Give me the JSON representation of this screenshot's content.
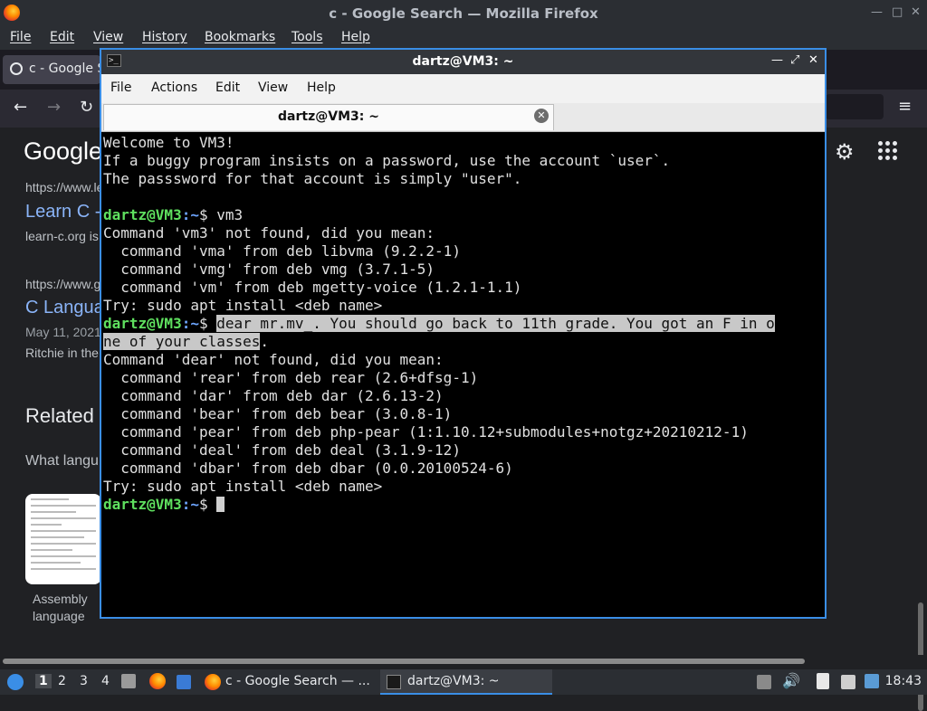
{
  "firefox": {
    "window_title": "c - Google Search — Mozilla Firefox",
    "menu": [
      "File",
      "Edit",
      "View",
      "History",
      "Bookmarks",
      "Tools",
      "Help"
    ],
    "tab_title": "c - Google S",
    "nav": {
      "back": "←",
      "forward": "→",
      "reload": "↻",
      "menu": "≡"
    }
  },
  "google": {
    "logo": "Google",
    "results": [
      {
        "url": "https://www.le",
        "title": "Learn C -",
        "snippet": "learn-c.org is"
      },
      {
        "url": "https://www.g",
        "title": "C Langua",
        "date": "May 11, 2021",
        "snippet": "Ritchie in the"
      }
    ],
    "related_heading": "Related",
    "related_question": "What langu",
    "thumb_caption_1": "Assembly",
    "thumb_caption_2": "language"
  },
  "terminal": {
    "window_title": "dartz@VM3: ~",
    "menu": [
      "File",
      "Actions",
      "Edit",
      "View",
      "Help"
    ],
    "tab_title": "dartz@VM3: ~",
    "prompt_user": "dartz@VM3",
    "prompt_path": ":~",
    "prompt_sign": "$ ",
    "lines": {
      "l1": "Welcome to VM3!",
      "l2": "If a buggy program insists on a password, use the account `user`.",
      "l3": "The passsword for that account is simply \"user\".",
      "cmd1": "vm3",
      "l5": "Command 'vm3' not found, did you mean:",
      "l6": "  command 'vma' from deb libvma (9.2.2-1)",
      "l7": "  command 'vmg' from deb vmg (3.7.1-5)",
      "l8": "  command 'vm' from deb mgetty-voice (1.2.1-1.1)",
      "l9": "Try: sudo apt install <deb name>",
      "cmd2_hl_a": "dear mr.mv_. You should go back to 11th grade. You got an F in o",
      "cmd2_hl_b": "ne of your classes",
      "cmd2_tail": ".",
      "l12": "Command 'dear' not found, did you mean:",
      "l13": "  command 'rear' from deb rear (2.6+dfsg-1)",
      "l14": "  command 'dar' from deb dar (2.6.13-2)",
      "l15": "  command 'bear' from deb bear (3.0.8-1)",
      "l16": "  command 'pear' from deb php-pear (1:1.10.12+submodules+notgz+20210212-1)",
      "l17": "  command 'deal' from deb deal (3.1.9-12)",
      "l18": "  command 'dbar' from deb dbar (0.0.20100524-6)",
      "l19": "Try: sudo apt install <deb name>"
    }
  },
  "taskbar": {
    "workspaces": [
      "1",
      "2",
      "3",
      "4"
    ],
    "firefox_task": "c - Google Search — ...",
    "terminal_task": "dartz@VM3: ~",
    "clock": "18:43"
  },
  "colors": {
    "terminal_border": "#3a8ee6",
    "prompt_user": "#5fe05f",
    "prompt_path": "#6ea6ff",
    "link": "#8ab4f8"
  }
}
